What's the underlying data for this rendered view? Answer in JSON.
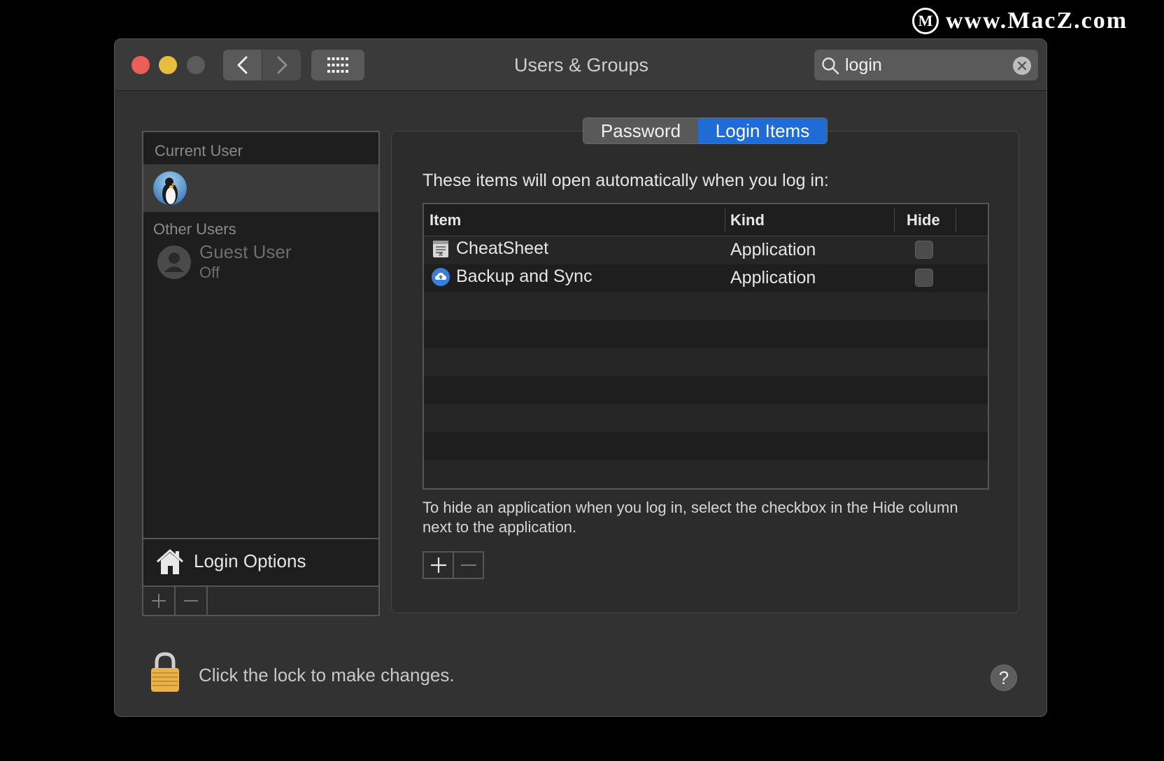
{
  "watermark": {
    "text": "www.MacZ.com",
    "logo_letter": "M"
  },
  "window": {
    "title": "Users & Groups"
  },
  "toolbar": {
    "back_icon": "chevron-left-icon",
    "forward_icon": "chevron-right-icon",
    "grid_icon": "grid-icon"
  },
  "search": {
    "value": "login",
    "placeholder": "Search"
  },
  "users": {
    "current_user_label": "Current User",
    "other_users_label": "Other Users",
    "guest": {
      "name": "Guest User",
      "status": "Off"
    },
    "login_options_label": "Login Options"
  },
  "tabs": [
    {
      "label": "Password",
      "selected": false
    },
    {
      "label": "Login Items",
      "selected": true
    }
  ],
  "login_items": {
    "intro": "These items will open automatically when you log in:",
    "columns": {
      "item": "Item",
      "kind": "Kind",
      "hide": "Hide"
    },
    "rows": [
      {
        "name": "CheatSheet",
        "kind": "Application",
        "hide": false,
        "icon": "cheatsheet-app-icon"
      },
      {
        "name": "Backup and Sync",
        "kind": "Application",
        "hide": false,
        "icon": "backup-sync-app-icon"
      }
    ],
    "hint": "To hide an application when you log in, select the checkbox in the Hide column next to the application."
  },
  "footer": {
    "lock_text": "Click the lock to make changes.",
    "help_label": "?"
  },
  "colors": {
    "accent": "#1f6cd6",
    "close": "#ec5f57",
    "minimize": "#e5bd3f"
  }
}
